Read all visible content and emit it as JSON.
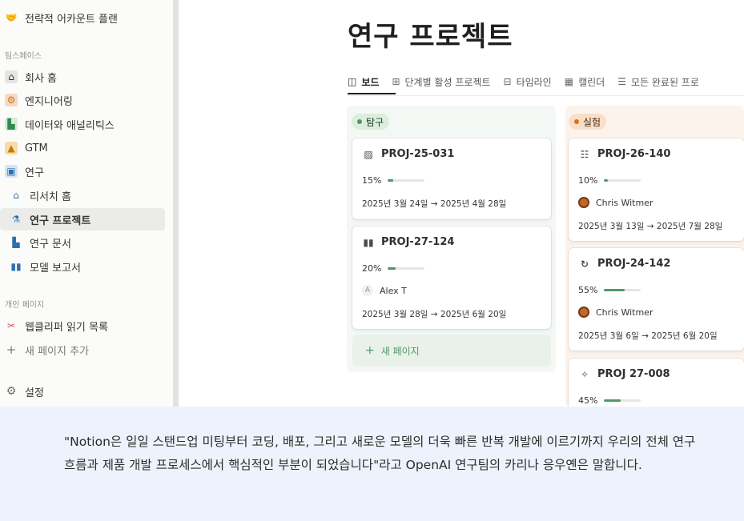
{
  "sidebar": {
    "top_item": "전략적 어카운트 플랜",
    "teamspace_label": "팀스페이스",
    "items": [
      {
        "label": "회사 홈",
        "icon": "house-icon"
      },
      {
        "label": "엔지니어링",
        "icon": "gears-icon"
      },
      {
        "label": "데이터와 애널리틱스",
        "icon": "chart-icon"
      },
      {
        "label": "GTM",
        "icon": "rocket-icon"
      },
      {
        "label": "연구",
        "icon": "clipboard-icon"
      },
      {
        "label": "리서치 홈",
        "icon": "house-icon"
      },
      {
        "label": "연구 프로젝트",
        "icon": "flask-icon"
      },
      {
        "label": "연구 문서",
        "icon": "document-icon"
      },
      {
        "label": "모델 보고서",
        "icon": "book-icon"
      }
    ],
    "personal_label": "개인 페이지",
    "personal_items": [
      {
        "label": "웹클리퍼 읽기 목록",
        "icon": "scissors-icon"
      }
    ],
    "add_page": "새 페이지 추가",
    "settings": "설정"
  },
  "page": {
    "title": "연구 프로젝트"
  },
  "tabs": [
    {
      "label": "보드",
      "icon": "board-icon",
      "active": true
    },
    {
      "label": "단계별 활성 프로젝트",
      "icon": "table-icon"
    },
    {
      "label": "타임라인",
      "icon": "timeline-icon"
    },
    {
      "label": "캘린더",
      "icon": "calendar-icon"
    },
    {
      "label": "모든 완료된 프로",
      "icon": "list-icon"
    }
  ],
  "columns": {
    "explore": {
      "status": "탐구",
      "cards": [
        {
          "id": "PROJ-25-031",
          "icon": "image-icon",
          "progress_label": "15%",
          "progress": 0.15,
          "dates": "2025년 3월 24일 → 2025년 4월 28일"
        },
        {
          "id": "PROJ-27-124",
          "icon": "book-icon",
          "progress_label": "20%",
          "progress": 0.2,
          "person": "Alex T",
          "avatar_letter": "A",
          "dates": "2025년 3월 28일 → 2025년 6월 20일"
        }
      ],
      "new_page": "새 페이지"
    },
    "experiment": {
      "status": "실험",
      "cards": [
        {
          "id": "PROJ-26-140",
          "icon": "sliders-icon",
          "progress_label": "10%",
          "progress": 0.1,
          "person": "Chris Witmer",
          "dates": "2025년 3월 13일 → 2025년 7월 28일"
        },
        {
          "id": "PROJ-24-142",
          "icon": "refresh-icon",
          "progress_label": "55%",
          "progress": 0.55,
          "person": "Chris Witmer",
          "dates": "2025년 3월 6일 → 2025년 6월 20일"
        },
        {
          "id": "PROJ 27-008",
          "icon": "sparkles-icon",
          "progress_label": "45%",
          "progress": 0.45
        }
      ]
    }
  },
  "quote": {
    "text": "\"Notion은 일일 스탠드업 미팅부터 코딩, 배포, 그리고 새로운 모델의 더욱 빠른 반복 개발에 이르기까지 우리의 전체 연구 흐름과 제품 개발 프로세스에서 핵심적인 부분이 되었습니다\"라고 OpenAI 연구팀의 카리나 응우옌은 말합니다."
  },
  "colors": {
    "accent_green": "#4f9768",
    "accent_orange": "#d9730d",
    "quote_bg": "#edf3fc"
  }
}
